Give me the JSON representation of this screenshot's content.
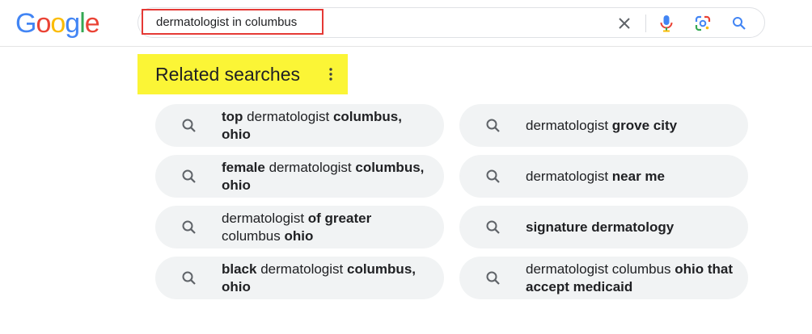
{
  "logo": {
    "letters": [
      "G",
      "o",
      "o",
      "g",
      "l",
      "e"
    ],
    "colors": [
      "#4285F4",
      "#EA4335",
      "#FBBC05",
      "#4285F4",
      "#34A853",
      "#EA4335"
    ]
  },
  "search": {
    "query": "dermatologist in columbus",
    "clear_icon": "close-icon",
    "voice_icon": "microphone-icon",
    "lens_icon": "google-lens-icon",
    "search_icon": "search-icon"
  },
  "related": {
    "title": "Related searches",
    "menu_icon": "more-vert-icon",
    "left": [
      {
        "parts": [
          {
            "t": "top",
            "b": true
          },
          {
            "t": " dermatologist ",
            "b": false
          },
          {
            "t": "columbus, ohio",
            "b": true
          }
        ]
      },
      {
        "parts": [
          {
            "t": "female",
            "b": true
          },
          {
            "t": " dermatologist ",
            "b": false
          },
          {
            "t": "columbus, ohio",
            "b": true
          }
        ]
      },
      {
        "parts": [
          {
            "t": "dermatologist ",
            "b": false
          },
          {
            "t": "of greater",
            "b": true
          },
          {
            "t": " columbus ",
            "b": false
          },
          {
            "t": "ohio",
            "b": true
          }
        ]
      },
      {
        "parts": [
          {
            "t": "black",
            "b": true
          },
          {
            "t": " dermatologist ",
            "b": false
          },
          {
            "t": "columbus, ohio",
            "b": true
          }
        ]
      }
    ],
    "right": [
      {
        "parts": [
          {
            "t": "dermatologist ",
            "b": false
          },
          {
            "t": "grove city",
            "b": true
          }
        ]
      },
      {
        "parts": [
          {
            "t": "dermatologist ",
            "b": false
          },
          {
            "t": "near me",
            "b": true
          }
        ]
      },
      {
        "parts": [
          {
            "t": "signature dermatology",
            "b": true
          }
        ]
      },
      {
        "parts": [
          {
            "t": "dermatologist columbus ",
            "b": false
          },
          {
            "t": "ohio that accept medicaid",
            "b": true
          }
        ]
      }
    ]
  },
  "colors": {
    "chip_bg": "#f1f3f4",
    "highlight_yellow": "#fbf536",
    "annotation_red": "#e53935"
  }
}
